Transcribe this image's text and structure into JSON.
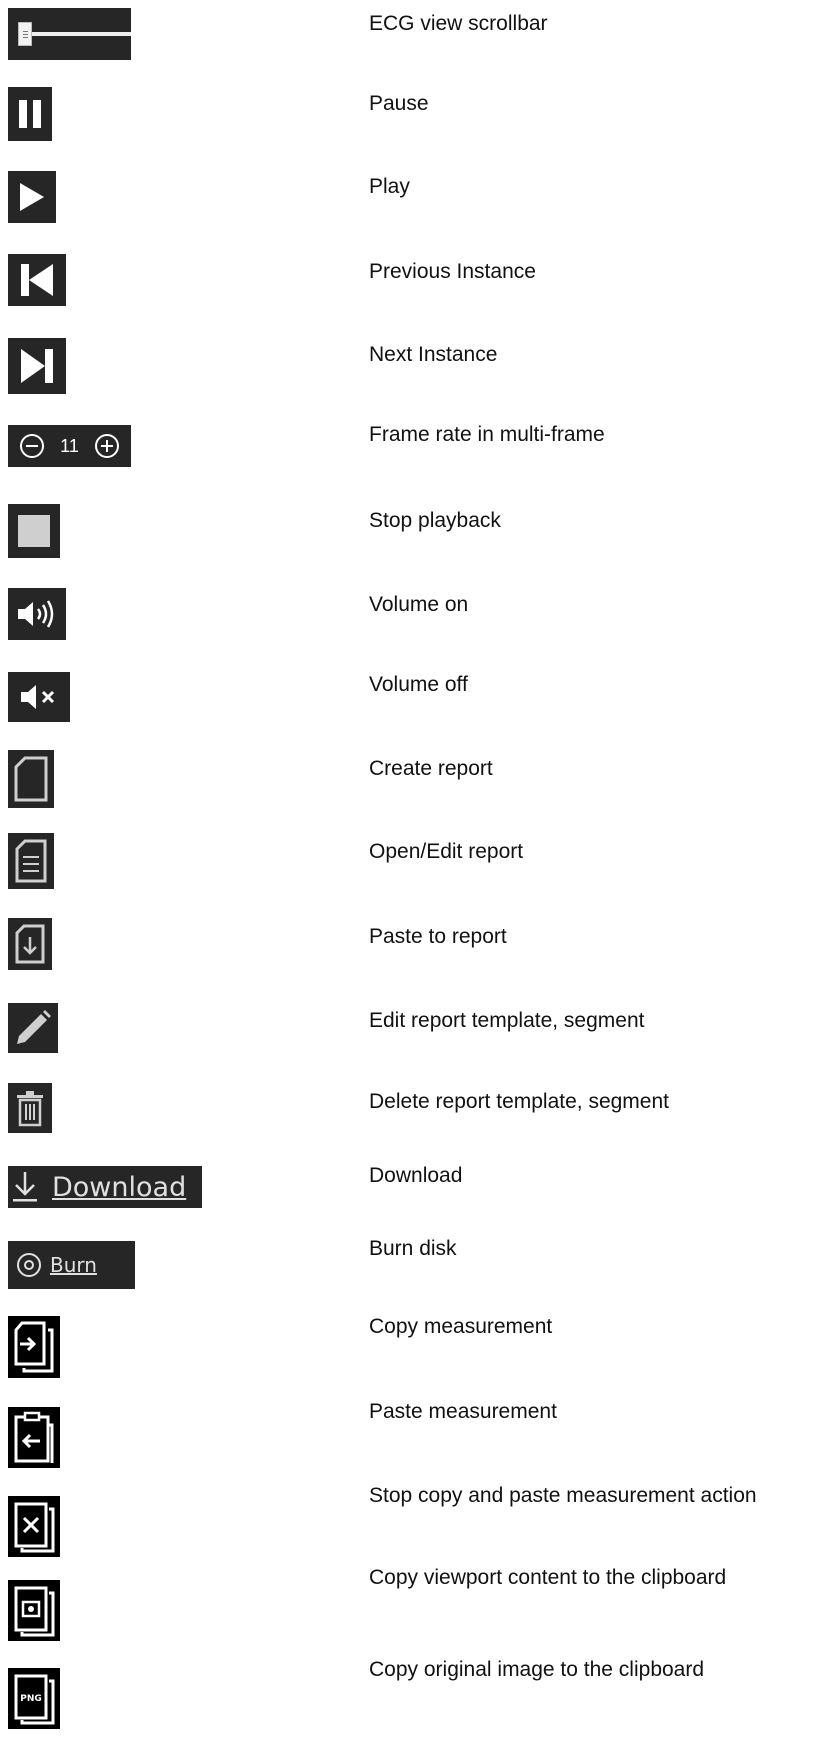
{
  "rows": [
    {
      "icon": "ecg-scrollbar-icon",
      "label": "ECG view scrollbar"
    },
    {
      "icon": "pause-icon",
      "label": "Pause"
    },
    {
      "icon": "play-icon",
      "label": "Play"
    },
    {
      "icon": "previous-instance-icon",
      "label": "Previous Instance"
    },
    {
      "icon": "next-instance-icon",
      "label": "Next Instance"
    },
    {
      "icon": "frame-rate-icon",
      "label": "Frame rate in multi-frame",
      "value": "11"
    },
    {
      "icon": "stop-icon",
      "label": "Stop playback"
    },
    {
      "icon": "volume-on-icon",
      "label": "Volume on"
    },
    {
      "icon": "volume-off-icon",
      "label": "Volume off"
    },
    {
      "icon": "create-report-icon",
      "label": "Create report"
    },
    {
      "icon": "open-report-icon",
      "label": "Open/Edit report"
    },
    {
      "icon": "paste-report-icon",
      "label": "Paste to report"
    },
    {
      "icon": "pencil-icon",
      "label": "Edit report template, segment"
    },
    {
      "icon": "trash-icon",
      "label": "Delete report template, segment"
    },
    {
      "icon": "download-icon",
      "label": "Download",
      "button_text": "Download"
    },
    {
      "icon": "burn-disc-icon",
      "label": "Burn disk",
      "button_text": "Burn"
    },
    {
      "icon": "copy-measurement-icon",
      "label": "Copy measurement"
    },
    {
      "icon": "paste-measurement-icon",
      "label": "Paste measurement"
    },
    {
      "icon": "stop-copy-paste-icon",
      "label": "Stop copy and paste measurement action"
    },
    {
      "icon": "copy-viewport-icon",
      "label": "Copy viewport content to the clipboard"
    },
    {
      "icon": "copy-original-image-icon",
      "label": "Copy original image to the clipboard",
      "badge": "PNG"
    }
  ],
  "colors": {
    "icon_bg": "#262626",
    "icon_fg": "#ffffff",
    "icon_gray": "#cccccc",
    "clip_bg": "#000000"
  }
}
